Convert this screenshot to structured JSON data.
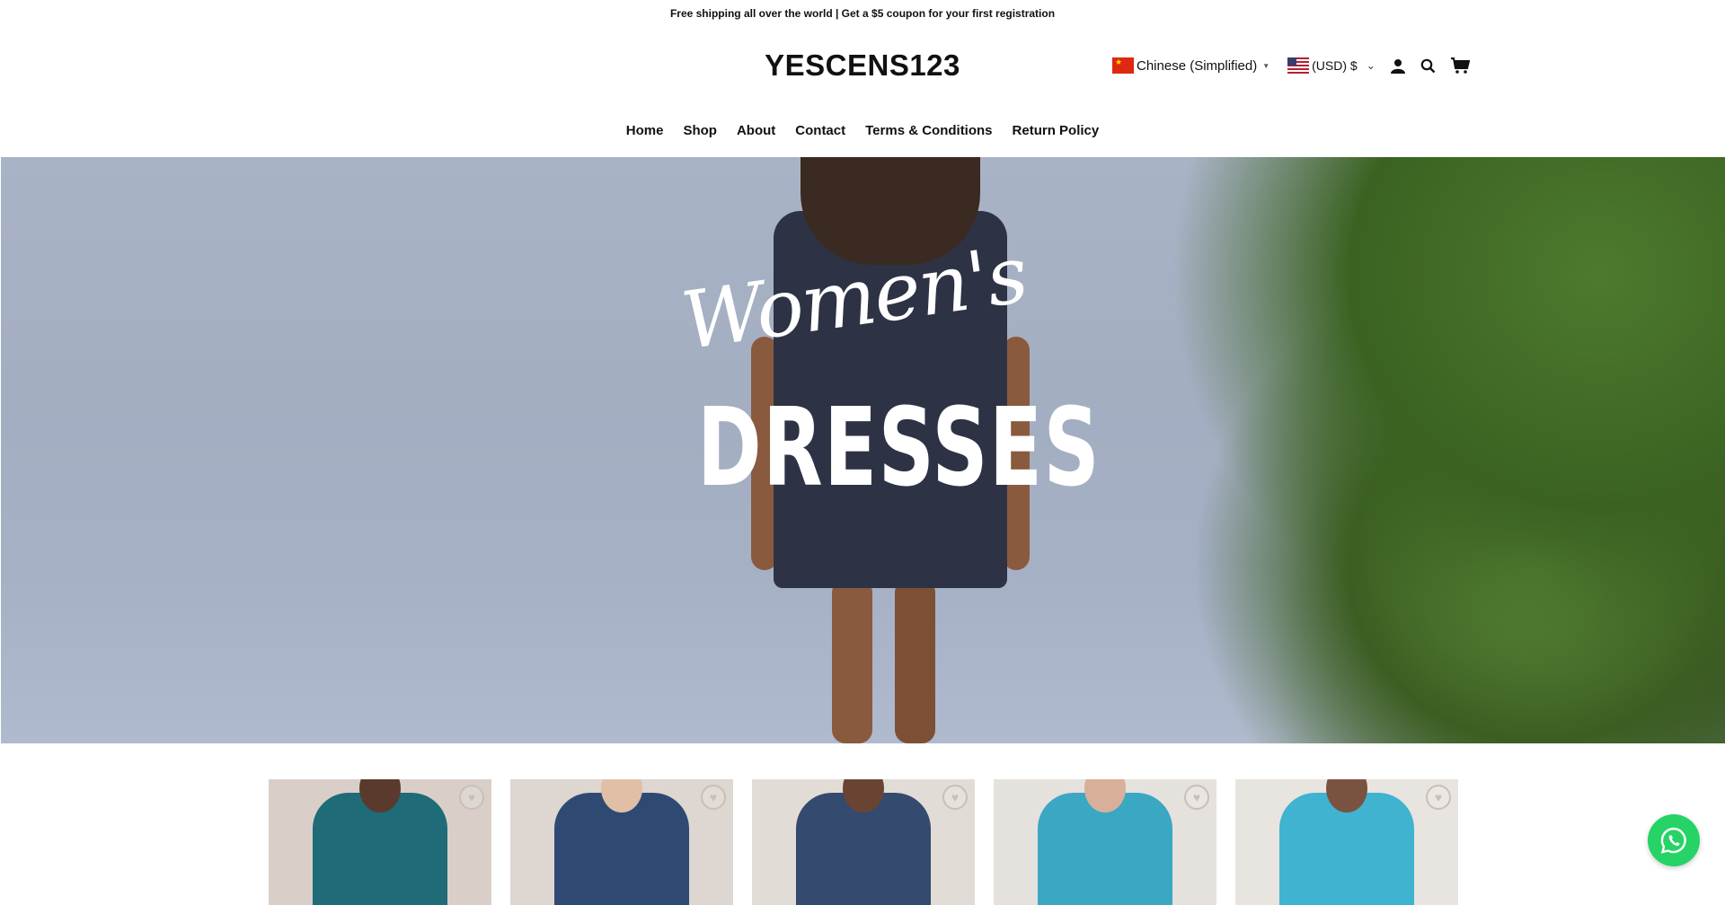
{
  "announcement": "Free shipping all over the world | Get a $5 coupon for your first registration",
  "logo": "YESCENS123",
  "language": {
    "label": "Chinese (Simplified)",
    "flag": "cn-flag-icon"
  },
  "currency": {
    "label": "(USD) $",
    "flag": "us-flag-icon"
  },
  "nav": [
    "Home",
    "Shop",
    "About",
    "Contact",
    "Terms & Conditions",
    "Return Policy"
  ],
  "hero": {
    "script_text": "Women's",
    "big_text": "DRESSES"
  },
  "products": [
    {
      "color": "#1f6b78",
      "bg": "#d9cfc8",
      "skin": "#5a3a2c"
    },
    {
      "color": "#2f4a72",
      "bg": "#ddd6d1",
      "skin": "#e0bfa6"
    },
    {
      "color": "#344a6e",
      "bg": "#e2dcd7",
      "skin": "#6a4433"
    },
    {
      "color": "#3aa7c3",
      "bg": "#e5e1dd",
      "skin": "#d8b09a"
    },
    {
      "color": "#3fb3cf",
      "bg": "#e8e4e0",
      "skin": "#7a5240"
    }
  ],
  "colors": {
    "whatsapp": "#25d366",
    "heart": "#c8c0b8"
  }
}
